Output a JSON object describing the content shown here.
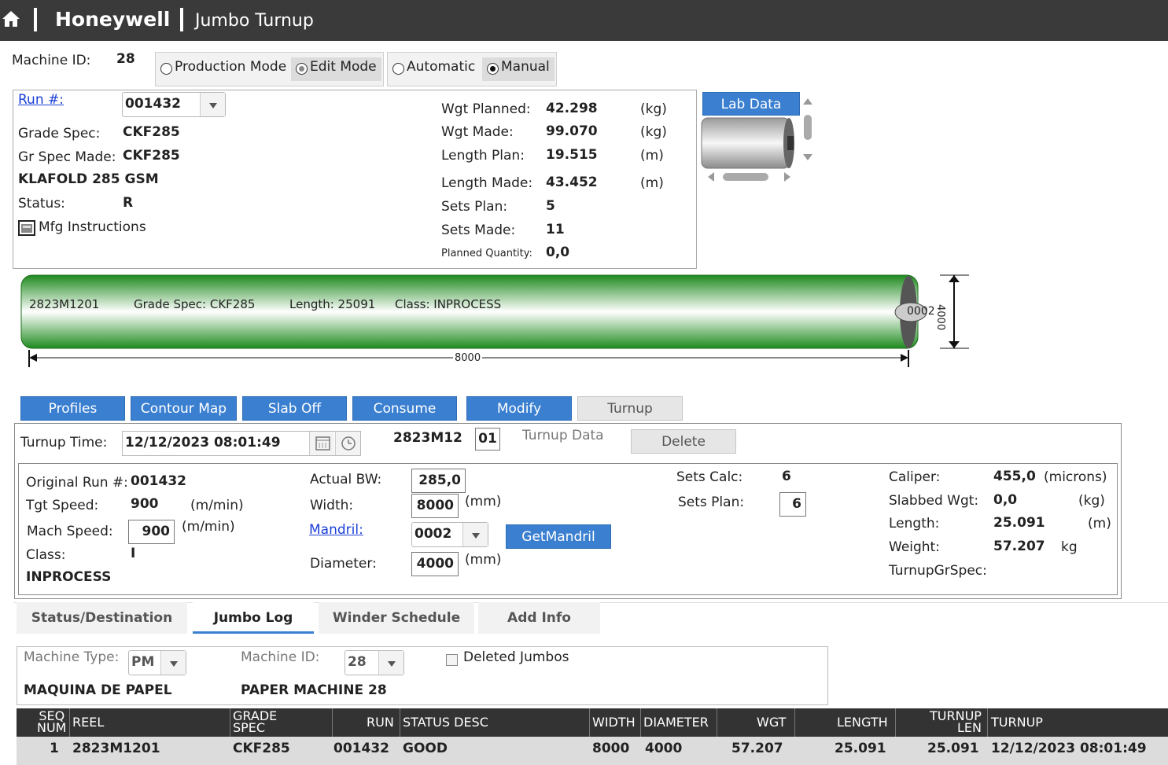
{
  "header": {
    "brand": "Honeywell",
    "title": "Jumbo Turnup"
  },
  "machine": {
    "label": "Machine ID:",
    "value": "28"
  },
  "mode": {
    "production": "Production Mode",
    "edit": "Edit Mode",
    "automatic": "Automatic",
    "manual": "Manual"
  },
  "run": {
    "run_label": "Run #:",
    "run_value": "001432",
    "grade_spec_label": "Grade Spec:",
    "grade_spec": "CKF285",
    "gr_spec_made_label": "Gr Spec Made:",
    "gr_spec_made": "CKF285",
    "grade_desc": "KLAFOLD 285 GSM",
    "status_label": "Status:",
    "status": "R",
    "mfg_instructions": "Mfg Instructions",
    "wgt_planned_label": "Wgt Planned:",
    "wgt_planned": "42.298",
    "wgt_planned_unit": "(kg)",
    "wgt_made_label": "Wgt Made:",
    "wgt_made": "99.070",
    "wgt_made_unit": "(kg)",
    "length_plan_label": "Length Plan:",
    "length_plan": "19.515",
    "length_plan_unit": "(m)",
    "length_made_label": "Length Made:",
    "length_made": "43.452",
    "length_made_unit": "(m)",
    "sets_plan_label": "Sets Plan:",
    "sets_plan": "5",
    "sets_made_label": "Sets Made:",
    "sets_made": "11",
    "planned_qty_label": "Planned Quantity:",
    "planned_qty": "0,0"
  },
  "lab_data": "Lab Data",
  "reel": {
    "id": "2823M1201",
    "grade": "Grade Spec: CKF285",
    "length": "Length: 25091",
    "class": "Class: INPROCESS",
    "width_dim": "8000",
    "diameter_dim": "4000",
    "core": "0002"
  },
  "actions": {
    "profiles": "Profiles",
    "contour": "Contour Map",
    "slab_off": "Slab Off",
    "consume": "Consume",
    "modify": "Modify",
    "turnup": "Turnup"
  },
  "turnup": {
    "time_label": "Turnup Time:",
    "time": "12/12/2023 08:01:49",
    "reel_prefix": "2823M12",
    "reel_suffix": "01",
    "data_label": "Turnup Data",
    "delete": "Delete",
    "orig_run_label": "Original Run #:",
    "orig_run": "001432",
    "tgt_speed_label": "Tgt Speed:",
    "tgt_speed": "900",
    "tgt_speed_unit": "(m/min)",
    "mach_speed_label": "Mach Speed:",
    "mach_speed": "900",
    "mach_speed_unit": "(m/min)",
    "class_label": "Class:",
    "class_value": "I",
    "class_desc": "INPROCESS",
    "actual_bw_label": "Actual BW:",
    "actual_bw": "285,0",
    "width_label": "Width:",
    "width": "8000",
    "width_unit": "(mm)",
    "mandril_label": "Mandril:",
    "mandril": "0002",
    "get_mandril": "GetMandril",
    "diameter_label": "Diameter:",
    "diameter": "4000",
    "diameter_unit": "(mm)",
    "sets_calc_label": "Sets Calc:",
    "sets_calc": "6",
    "sets_plan_label": "Sets Plan:",
    "sets_plan": "6",
    "caliper_label": "Caliper:",
    "caliper": "455,0",
    "caliper_unit": "(microns)",
    "slabbed_label": "Slabbed Wgt:",
    "slabbed": "0,0",
    "slabbed_unit": "(kg)",
    "length_label": "Length:",
    "length": "25.091",
    "length_unit": "(m)",
    "weight_label": "Weight:",
    "weight": "57.207",
    "weight_unit": "kg",
    "turnup_gr_spec_label": "TurnupGrSpec:"
  },
  "tabs": [
    "Status/Destination",
    "Jumbo Log",
    "Winder Schedule",
    "Add Info"
  ],
  "filter": {
    "machine_type_label": "Machine Type:",
    "machine_type": "PM",
    "machine_type_desc": "MAQUINA DE PAPEL",
    "machine_id_label": "Machine ID:",
    "machine_id": "28",
    "machine_id_desc": "PAPER MACHINE 28",
    "deleted_label": "Deleted Jumbos"
  },
  "table": {
    "headers": {
      "seq1": "SEQ",
      "seq2": "NUM",
      "reel": "REEL",
      "grade1": "GRADE",
      "grade2": "SPEC",
      "run": "RUN",
      "status": "STATUS DESC",
      "width": "WIDTH",
      "diameter": "DIAMETER",
      "wgt": "WGT",
      "length": "LENGTH",
      "tlen1": "TURNUP",
      "tlen2": "LEN",
      "turnup": "TURNUP"
    },
    "row": {
      "seq": "1",
      "reel": "2823M1201",
      "grade": "CKF285",
      "run": "001432",
      "status": "GOOD",
      "width": "8000",
      "diameter": "4000",
      "wgt": "57.207",
      "length": "25.091",
      "tlen": "25.091",
      "turnup": "12/12/2023 08:01:49"
    }
  }
}
